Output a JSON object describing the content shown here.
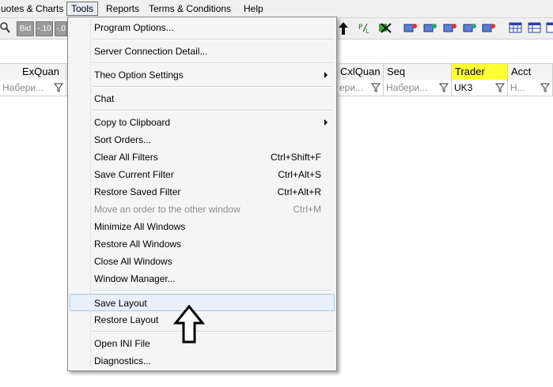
{
  "menubar": {
    "items": [
      "uotes & Charts",
      "Tools",
      "Reports",
      "Terms & Conditions",
      "Help"
    ]
  },
  "toolbar": {
    "bid_label": "Bid",
    "minus10_label": "-.10",
    "minus05_label": "-.0",
    "pl_label": "P/L"
  },
  "grid": {
    "columns": [
      "ExQuan",
      "CxlQuan",
      "Seq",
      "Trader",
      "Acct"
    ],
    "filters": {
      "exquan": "Набери...",
      "cxlquan": "ери...",
      "seq": "Набери...",
      "trader": "UK3",
      "acct": "Н..."
    }
  },
  "menu": {
    "items": [
      {
        "label": "Program Options..."
      },
      {
        "label": "Server Connection Detail..."
      },
      {
        "label": "Theo Option Settings",
        "submenu": true
      },
      {
        "label": "Chat"
      },
      {
        "label": "Copy to Clipboard",
        "submenu": true
      },
      {
        "label": "Sort Orders..."
      },
      {
        "label": "Clear All Filters",
        "shortcut": "Ctrl+Shift+F"
      },
      {
        "label": "Save Current Filter",
        "shortcut": "Ctrl+Alt+S"
      },
      {
        "label": "Restore Saved Filter",
        "shortcut": "Ctrl+Alt+R"
      },
      {
        "label": "Move an order to the other window",
        "shortcut": "Ctrl+M",
        "disabled": true
      },
      {
        "label": "Minimize All Windows"
      },
      {
        "label": "Restore All Windows"
      },
      {
        "label": "Close All Windows"
      },
      {
        "label": "Window Manager..."
      },
      {
        "label": "Save Layout",
        "highlighted": true
      },
      {
        "label": "Restore Layout"
      },
      {
        "label": "Open INI File"
      },
      {
        "label": "Diagnostics..."
      }
    ]
  },
  "colors": {
    "trader_highlight": "#ffff33",
    "menu_hover": "#e8f0fb"
  }
}
